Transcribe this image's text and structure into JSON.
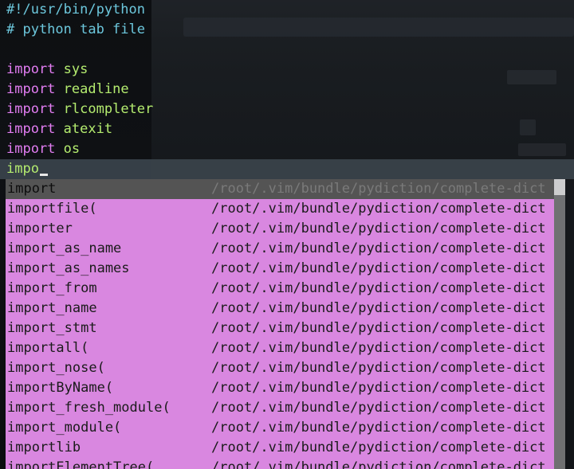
{
  "editor": {
    "lines": [
      {
        "type": "comment",
        "text": "#!/usr/bin/python"
      },
      {
        "type": "comment",
        "text": "# python tab file"
      },
      {
        "type": "blank",
        "text": ""
      },
      {
        "type": "import",
        "keyword": "import",
        "module": "sys"
      },
      {
        "type": "import",
        "keyword": "import",
        "module": "readline"
      },
      {
        "type": "import",
        "keyword": "import",
        "module": "rlcompleter"
      },
      {
        "type": "import",
        "keyword": "import",
        "module": "atexit"
      },
      {
        "type": "import",
        "keyword": "import",
        "module": "os"
      }
    ],
    "current_input": "impo"
  },
  "completion_menu": {
    "items": [
      {
        "word": "import",
        "menu": "/root/.vim/bundle/pydiction/complete-dict",
        "selected": true
      },
      {
        "word": "importfile(",
        "menu": "/root/.vim/bundle/pydiction/complete-dict"
      },
      {
        "word": "importer",
        "menu": "/root/.vim/bundle/pydiction/complete-dict"
      },
      {
        "word": "import_as_name",
        "menu": "/root/.vim/bundle/pydiction/complete-dict"
      },
      {
        "word": "import_as_names",
        "menu": "/root/.vim/bundle/pydiction/complete-dict"
      },
      {
        "word": "import_from",
        "menu": "/root/.vim/bundle/pydiction/complete-dict"
      },
      {
        "word": "import_name",
        "menu": "/root/.vim/bundle/pydiction/complete-dict"
      },
      {
        "word": "import_stmt",
        "menu": "/root/.vim/bundle/pydiction/complete-dict"
      },
      {
        "word": "importall(",
        "menu": "/root/.vim/bundle/pydiction/complete-dict"
      },
      {
        "word": "import_nose(",
        "menu": "/root/.vim/bundle/pydiction/complete-dict"
      },
      {
        "word": "importByName(",
        "menu": "/root/.vim/bundle/pydiction/complete-dict"
      },
      {
        "word": "import_fresh_module(",
        "menu": "/root/.vim/bundle/pydiction/complete-dict"
      },
      {
        "word": "import_module(",
        "menu": "/root/.vim/bundle/pydiction/complete-dict"
      },
      {
        "word": "importlib",
        "menu": "/root/.vim/bundle/pydiction/complete-dict"
      },
      {
        "word": "importElementTree(",
        "menu": "/root/.vim/bundle/pydiction/complete-dict"
      }
    ]
  },
  "colors": {
    "comment": "#6cc7dc",
    "keyword": "#e27df2",
    "module": "#b4ec6f",
    "popup_bg": "#d987e0",
    "popup_selected_bg": "#545454",
    "current_line_bg": "#39424a"
  }
}
